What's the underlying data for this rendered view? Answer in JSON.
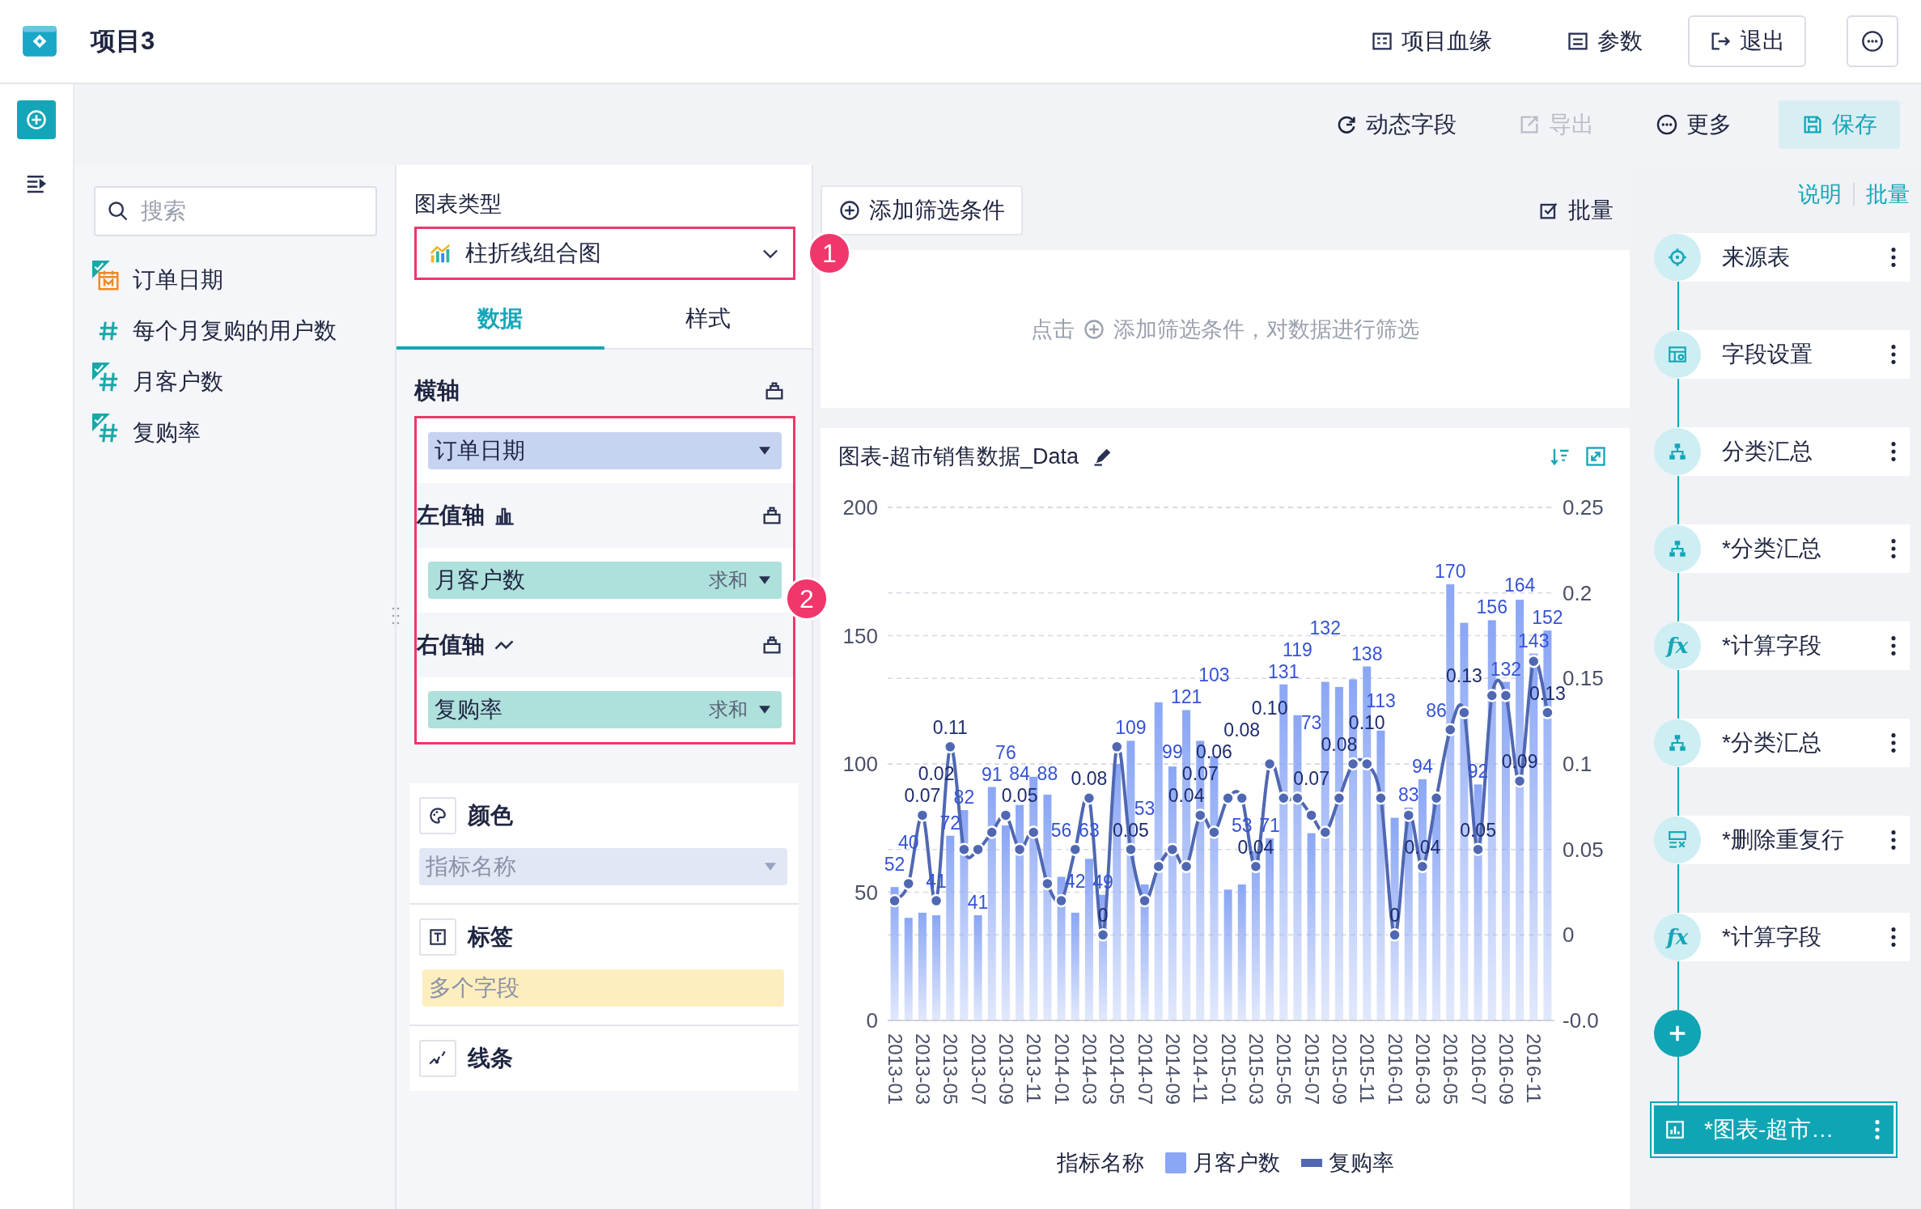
{
  "app": {
    "title": "项目3"
  },
  "header_actions": [
    {
      "label": "项目血缘",
      "kind": "lineage"
    },
    {
      "label": "参数",
      "kind": "params"
    },
    {
      "label": "退出",
      "kind": "exit"
    }
  ],
  "toolbar": [
    {
      "label": "动态字段",
      "kind": "dynamic",
      "disabled": false
    },
    {
      "label": "导出",
      "kind": "export",
      "disabled": true
    },
    {
      "label": "更多",
      "kind": "more",
      "disabled": false
    },
    {
      "label": "保存",
      "kind": "save",
      "disabled": false
    }
  ],
  "fields": {
    "search": {
      "placeholder": "搜索"
    },
    "items": [
      {
        "label": "订单日期",
        "kind": "date",
        "checked": true
      },
      {
        "label": "每个月复购的用户数",
        "kind": "number",
        "checked": false
      },
      {
        "label": "月客户数",
        "kind": "number",
        "checked": true
      },
      {
        "label": "复购率",
        "kind": "number",
        "checked": true
      }
    ]
  },
  "config": {
    "chart_type_label": "图表类型",
    "chart_type": "柱折线组合图",
    "tabs": [
      {
        "label": "数据",
        "selected": true
      },
      {
        "label": "样式",
        "selected": false
      }
    ],
    "axes": [
      {
        "title": "横轴",
        "field": {
          "label": "订单日期",
          "kind": "dimension"
        }
      },
      {
        "title": "左值轴",
        "kind": "bar",
        "field": {
          "label": "月客户数",
          "kind": "measure",
          "aggregate": "求和"
        }
      },
      {
        "title": "右值轴",
        "kind": "line",
        "field": {
          "label": "复购率",
          "kind": "measure",
          "aggregate": "求和"
        }
      }
    ],
    "marks": [
      {
        "title": "颜色",
        "kind": "color",
        "slot": {
          "text": "指标名称",
          "kind": "dropdown"
        }
      },
      {
        "title": "标签",
        "kind": "label",
        "slot": {
          "text": "多个字段",
          "kind": "drop-zone"
        }
      },
      {
        "title": "线条",
        "kind": "line"
      }
    ]
  },
  "callouts": [
    {
      "number": "1"
    },
    {
      "number": "2"
    }
  ],
  "filter": {
    "add_button": "添加筛选条件",
    "batch": "批量",
    "hint_before": "点击",
    "hint_after": "添加筛选条件，对数据进行筛选"
  },
  "chart": {
    "title": "图表-超市销售数据_Data",
    "legend_title": "指标名称",
    "chart_data": {
      "type": "bar",
      "grid": true,
      "categories": [
        "2013-01",
        null,
        "2013-03",
        null,
        "2013-05",
        null,
        "2013-07",
        null,
        "2013-09",
        null,
        "2013-11",
        null,
        "2014-01",
        null,
        "2014-03",
        null,
        "2014-05",
        null,
        "2014-07",
        null,
        "2014-09",
        null,
        "2014-11",
        null,
        "2015-01",
        null,
        "2015-03",
        null,
        "2015-05",
        null,
        "2015-07",
        null,
        "2015-09",
        null,
        "2015-11",
        null,
        "2016-01",
        null,
        "2016-03",
        null,
        "2016-05",
        null,
        "2016-07",
        null,
        "2016-09",
        null,
        "2016-11",
        null
      ],
      "series": [
        {
          "name": "月客户数",
          "color": "#8aa6f5",
          "type": "bar",
          "values": [
            52,
            40,
            42,
            41,
            72,
            82,
            41,
            91,
            76,
            84,
            95,
            88,
            56,
            42,
            63,
            49,
            100,
            109,
            53,
            124,
            99,
            121,
            109,
            103,
            51,
            53,
            66,
            71,
            131,
            119,
            73,
            132,
            130,
            133,
            138,
            113,
            79,
            83,
            94,
            86,
            170,
            155,
            92,
            156,
            132,
            164,
            143,
            152
          ]
        },
        {
          "name": "复购率",
          "color": "#5068b2",
          "type": "line",
          "axis": "y2",
          "marker": "circle",
          "values": [
            0.02,
            0.03,
            0.07,
            0.02,
            0.11,
            0.05,
            0.05,
            0.06,
            0.07,
            0.05,
            0.06,
            0.03,
            0.02,
            0.05,
            0.08,
            0,
            0.11,
            0.05,
            0.02,
            0.04,
            0.05,
            0.04,
            0.07,
            0.06,
            0.08,
            0.08,
            0.04,
            0.1,
            0.08,
            0.08,
            0.07,
            0.06,
            0.08,
            0.1,
            0.1,
            0.08,
            0,
            0.07,
            0.04,
            0.08,
            0.12,
            0.13,
            0.05,
            0.14,
            0.14,
            0.09,
            0.16,
            0.13
          ]
        }
      ],
      "value_labels": [
        [
          "52",
          "40",
          null,
          "41",
          "72",
          "82",
          "41",
          "91",
          "76",
          "84",
          null,
          "88",
          "56",
          "42",
          "63",
          "49",
          null,
          "109",
          "53",
          null,
          "99",
          "121",
          null,
          "103",
          null,
          "53",
          null,
          "71",
          "131",
          "119",
          "73",
          "132",
          null,
          null,
          "138",
          "113",
          null,
          "83",
          "94",
          "86",
          "170",
          null,
          "92",
          "156",
          "132",
          "164",
          "143",
          "152"
        ],
        [
          null,
          null,
          "0.07",
          "0.02",
          "0.11",
          null,
          null,
          null,
          null,
          "0.05",
          null,
          null,
          null,
          null,
          "0.08",
          "0",
          null,
          "0.05",
          null,
          null,
          null,
          "0.04",
          "0.07",
          "0.06",
          null,
          "0.08",
          "0.04",
          "0.10",
          null,
          null,
          "0.07",
          null,
          "0.08",
          null,
          "0.10",
          null,
          "0",
          null,
          "0.04",
          null,
          null,
          "0.13",
          "0.05",
          null,
          null,
          "0.09",
          null,
          "0.13"
        ]
      ],
      "ylim": [
        0,
        200
      ],
      "yticks": [
        0,
        50,
        100,
        150,
        200
      ],
      "y2lim": [
        -0.05,
        0.25
      ],
      "y2ticks": [
        {
          "value": -0.05,
          "label": "-0.0"
        },
        {
          "value": 0,
          "label": "0"
        },
        {
          "value": 0.05,
          "label": "0.05"
        },
        {
          "value": 0.1,
          "label": "0.1"
        },
        {
          "value": 0.15,
          "label": "0.15"
        },
        {
          "value": 0.2,
          "label": "0.2"
        },
        {
          "value": 0.25,
          "label": "0.25"
        }
      ]
    }
  },
  "pipeline": {
    "links": [
      "说明",
      "批量"
    ],
    "steps": [
      {
        "label": "来源表",
        "kind": "source",
        "selected": false
      },
      {
        "label": "字段设置",
        "kind": "fields",
        "selected": false
      },
      {
        "label": "分类汇总",
        "kind": "group",
        "selected": false
      },
      {
        "label": "*分类汇总",
        "kind": "group",
        "selected": false
      },
      {
        "label": "*计算字段",
        "kind": "calc",
        "glyph": "fx",
        "selected": false
      },
      {
        "label": "*分类汇总",
        "kind": "group",
        "selected": false
      },
      {
        "label": "*删除重复行",
        "kind": "dedupe",
        "selected": false
      },
      {
        "label": "*计算字段",
        "kind": "calc",
        "glyph": "fx",
        "selected": false
      },
      {
        "label": "*图表-超市…",
        "kind": "chart",
        "selected": true
      }
    ]
  }
}
